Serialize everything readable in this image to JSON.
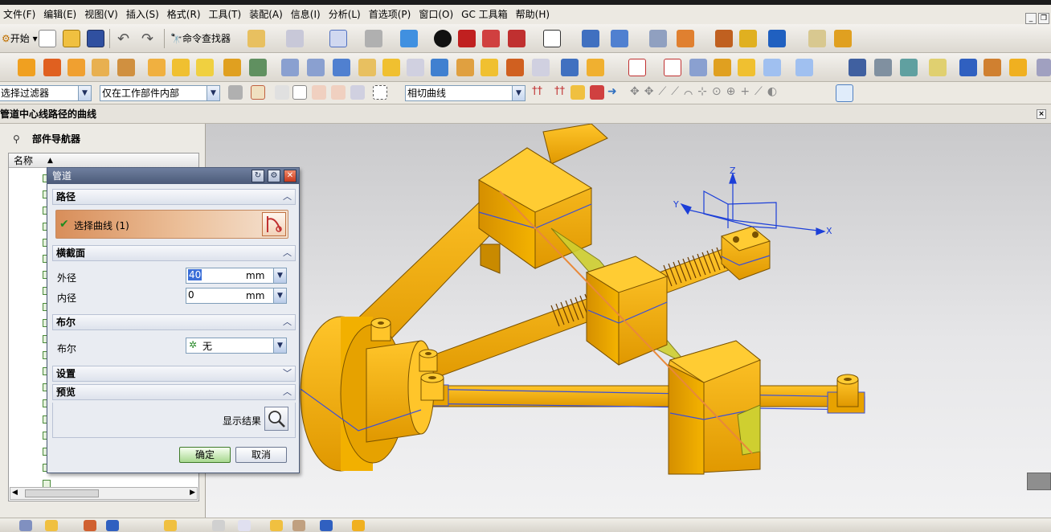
{
  "menu": {
    "items": [
      "文件(F)",
      "编辑(E)",
      "视图(V)",
      "插入(S)",
      "格式(R)",
      "工具(T)",
      "装配(A)",
      "信息(I)",
      "分析(L)",
      "首选项(P)",
      "窗口(O)",
      "GC 工具箱",
      "帮助(H)"
    ]
  },
  "toolbar": {
    "start_label": "开始",
    "command_finder_label": "命令查找器"
  },
  "selection_bar": {
    "filter": "选择过滤器",
    "scope": "仅在工作部件内部",
    "curve_rule": "相切曲线"
  },
  "cue_line": "管道中心线路径的曲线",
  "navigator": {
    "title": "部件导航器",
    "column_name": "名称"
  },
  "dialog": {
    "title": "管道",
    "sections": {
      "path": "路径",
      "cross_section": "横截面",
      "boolean": "布尔",
      "settings": "设置",
      "preview": "预览"
    },
    "select_curve_label": "选择曲线 (1)",
    "outer_diameter_label": "外径",
    "outer_diameter_value": "40",
    "inner_diameter_label": "内径",
    "inner_diameter_value": "0",
    "unit": "mm",
    "boolean_label": "布尔",
    "boolean_value": "无",
    "show_result_label": "显示结果",
    "ok_label": "确定",
    "cancel_label": "取消"
  },
  "triad": {
    "x": "X",
    "y": "Y",
    "z": "Z"
  },
  "colors": {
    "part": "#f5b400",
    "part_shade": "#c98a00",
    "edge": "#3a4fd8",
    "path_line": "#e8893a",
    "dialog_title": "#4b5a78"
  }
}
